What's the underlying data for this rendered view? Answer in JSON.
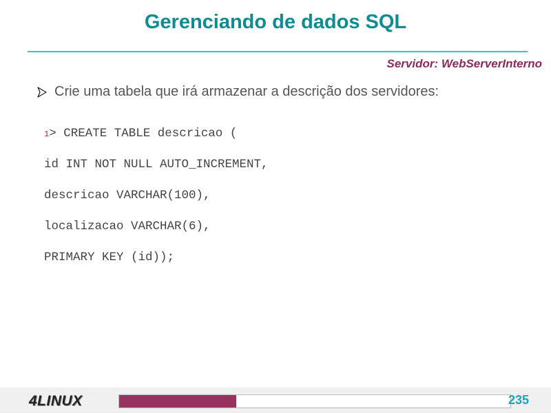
{
  "slide": {
    "title": "Gerenciando de dados SQL",
    "server_label": "Servidor: WebServerInterno",
    "bullet": "Crie uma tabela que irá armazenar a descrição dos servidores:",
    "code_lines": [
      {
        "prefix": "1",
        "text": "> CREATE TABLE descricao ("
      },
      {
        "prefix": "",
        "text": "id INT NOT NULL AUTO_INCREMENT,"
      },
      {
        "prefix": "",
        "text": "descricao VARCHAR(100),"
      },
      {
        "prefix": "",
        "text": "localizacao VARCHAR(6),"
      },
      {
        "prefix": "",
        "text": "PRIMARY KEY (id));"
      }
    ]
  },
  "footer": {
    "logo_text": "4LINUX",
    "page_number": "235",
    "progress_fraction": 0.3
  },
  "colors": {
    "title": "#0e8c8f",
    "rule": "#2cc7d1",
    "server_label": "#8a2b5c",
    "progress": "#98325e",
    "page_number": "#17a6b3"
  },
  "icons": {
    "bullet": "arrow-right-icon"
  }
}
